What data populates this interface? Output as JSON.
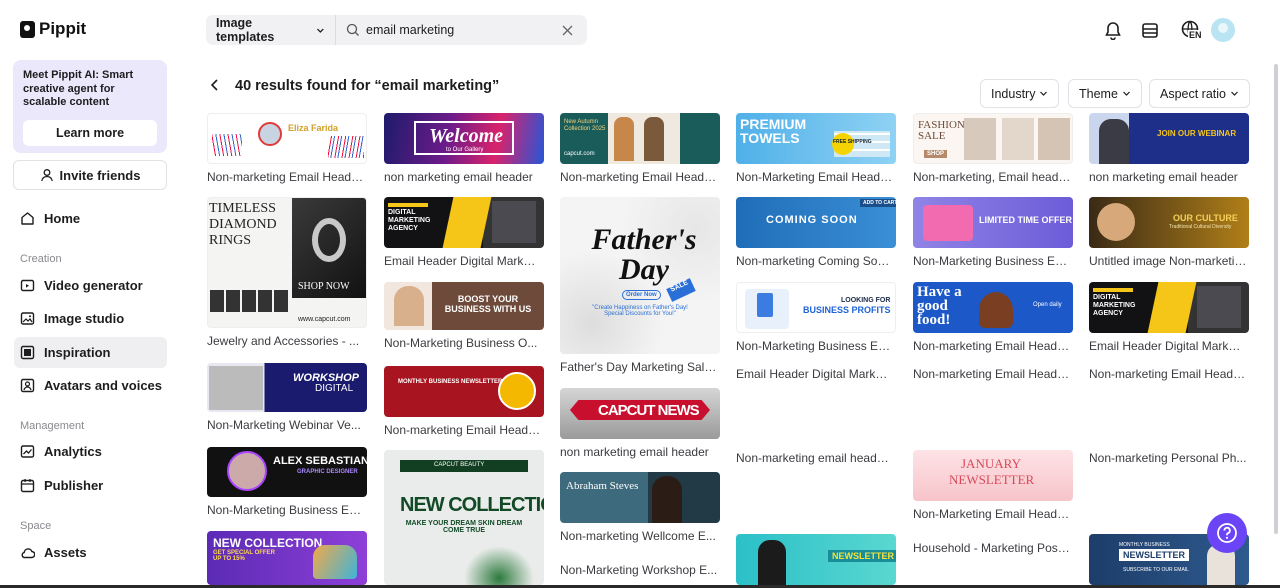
{
  "app": {
    "name": "Pippit"
  },
  "sidebar": {
    "promo_text": "Meet Pippit AI: Smart creative agent for scalable content",
    "learn_more": "Learn more",
    "invite": "Invite friends",
    "home": "Home",
    "creation_label": "Creation",
    "video_generator": "Video generator",
    "image_studio": "Image studio",
    "inspiration": "Inspiration",
    "avatars_voices": "Avatars and voices",
    "management_label": "Management",
    "analytics": "Analytics",
    "publisher": "Publisher",
    "space_label": "Space",
    "assets": "Assets"
  },
  "topbar": {
    "template_type": "Image templates",
    "search_value": "email marketing",
    "language": "EN"
  },
  "results": {
    "title": "40 results found for “email marketing”"
  },
  "filters": {
    "industry": "Industry",
    "theme": "Theme",
    "aspect_ratio": "Aspect ratio"
  },
  "thumb_text": {
    "eliza_name": "Eliza Farida",
    "welcome": "Welcome",
    "welcome_sub": "to Our Gallery",
    "autumn": "New Autumn Collection 2025",
    "capcut_com": "capcut.com",
    "premium_towels": "PREMIUM TOWELS",
    "free_shipping": "FREE SHIPPING",
    "fashion_sale": "FASHION SALE",
    "shop": "SHOP",
    "join_webinar": "JOIN OUR WEBINAR",
    "timeless": "TIMELESS DIAMOND RINGS",
    "shop_now": "SHOP NOW",
    "website": "www.capcut.com",
    "digital_agency": "DIGITAL MARKETING AGENCY",
    "boost": "BOOST YOUR BUSINESS WITH US",
    "fathers_day": "Father's Day",
    "fathers_quote": "\"Create Happiness on Father's Day! Special Discounts for You!\"",
    "order_now": "Order Now",
    "sale": "SALE",
    "coming_soon": "COMING SOON",
    "add_to_cart": "ADD TO CART",
    "limited_offer": "LIMITED TIME OFFER",
    "our_culture": "OUR CULTURE",
    "culture_sub": "Traditional Cultural Diversity",
    "looking_for": "LOOKING FOR",
    "business_profits": "BUSINESS PROFITS",
    "good_food": "Have a good food!",
    "open_daily": "Open daily",
    "workshop": "WORKSHOP",
    "digital": "DIGITAL",
    "monthly_newsletter": "MONTHLY BUSINESS NEWSLETTER",
    "capcut_news": "CAPCUT NEWS",
    "alex": "ALEX SEBASTIAN",
    "graphic_designer": "GRAPHIC DESIGNER",
    "capcut_beauty": "CAPCUT BEAUTY",
    "new_collection": "NEW COLLECTION",
    "skin_dream": "MAKE YOUR DREAM SKIN DREAM COME TRUE",
    "abraham": "Abraham Steves",
    "january": "JANUARY",
    "newsletter": "NEWSLETTER",
    "special_offer": "GET SPECIAL OFFER UP TO 15%",
    "monthly_business": "MONTHLY BUSINESS",
    "subscribe": "SUBSCRIBE TO OUR EMAIL"
  },
  "cards": [
    {
      "id": "c1",
      "caption": "Non-marketing Email Header..."
    },
    {
      "id": "c2",
      "caption": "non marketing email header"
    },
    {
      "id": "c3",
      "caption": "Non-marketing Email Header..."
    },
    {
      "id": "c4",
      "caption": "Non-Marketing Email Header..."
    },
    {
      "id": "c5",
      "caption": "Non-marketing, Email header..."
    },
    {
      "id": "c6",
      "caption": "non marketing email header"
    },
    {
      "id": "c7",
      "caption": "Jewelry and Accessories - ..."
    },
    {
      "id": "c8",
      "caption": "Email Header Digital Marketing..."
    },
    {
      "id": "c9",
      "caption": "Father's Day Marketing Sale..."
    },
    {
      "id": "c10",
      "caption": "Non-marketing Coming Soon..."
    },
    {
      "id": "c11",
      "caption": "Non-Marketing Business Email..."
    },
    {
      "id": "c12",
      "caption": "Untitled image Non-marketing..."
    },
    {
      "id": "c13",
      "caption": "Non-Marketing Business O..."
    },
    {
      "id": "c14",
      "caption": "Non-Marketing Business Em..."
    },
    {
      "id": "c15",
      "caption": "Non-marketing Email Header..."
    },
    {
      "id": "c16",
      "caption": "Email Header Digital Marketing..."
    },
    {
      "id": "c17",
      "caption": "Non-Marketing Webinar Ve..."
    },
    {
      "id": "c18",
      "caption": "Non-marketing Email Header..."
    },
    {
      "id": "c19",
      "caption": "non marketing email header"
    },
    {
      "id": "c20",
      "caption": "Email Header Digital Marketi..."
    },
    {
      "id": "c21",
      "caption": "Non-marketing Email Header..."
    },
    {
      "id": "c22",
      "caption": "Non-marketing Email Header..."
    },
    {
      "id": "c23",
      "caption": "Non-Marketing Business Em..."
    },
    {
      "id": "c24",
      "caption": "Non-marketing Wellcome E..."
    },
    {
      "id": "c25",
      "caption": "Non-marketing email header..."
    },
    {
      "id": "c26",
      "caption": "Non-Marketing Email Header..."
    },
    {
      "id": "c27",
      "caption": "Non-marketing Personal Ph..."
    },
    {
      "id": "c28",
      "caption": "Non-Marketing Workshop E..."
    },
    {
      "id": "c29",
      "caption": "Household - Marketing Post..."
    }
  ]
}
